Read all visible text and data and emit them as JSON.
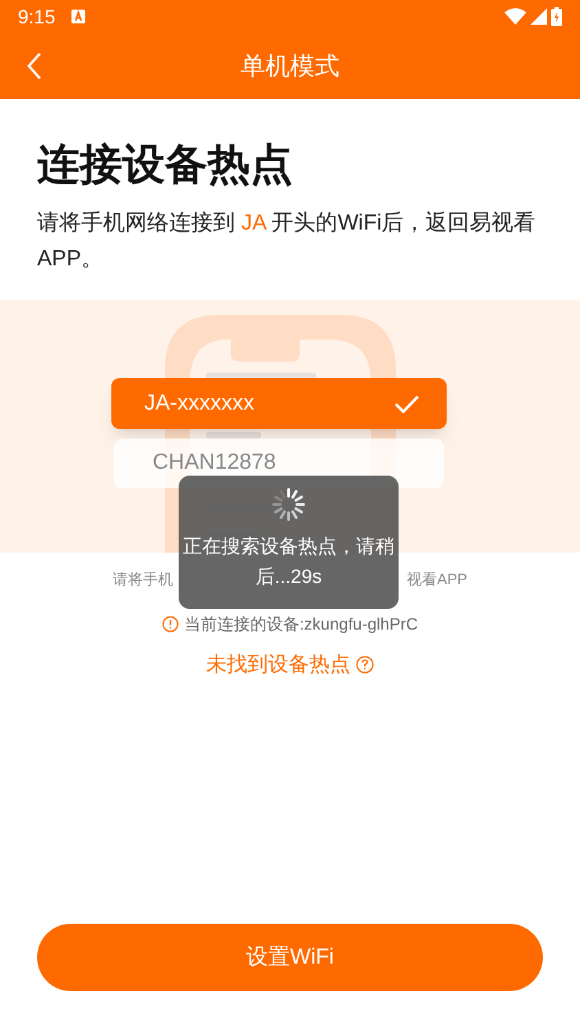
{
  "status_bar": {
    "time": "9:15"
  },
  "nav": {
    "title": "单机模式"
  },
  "heading": "连接设备热点",
  "description": "请将手机网络连接到 **JA** 开头的WiFi后，返回易视看APP。",
  "illustration": {
    "selected_network": {
      "name": "JA-xxxxxxx",
      "selected": true
    },
    "other_network": {
      "name": "CHAN12878",
      "selected": false
    }
  },
  "hint": {
    "left": "请将手机",
    "right": "视看APP"
  },
  "current_device": "当前连接的设备:zkungfu-glhPrC",
  "not_found_link": "未找到设备热点",
  "toast": {
    "message": "正在搜索设备热点，请稍后...29s"
  },
  "primary_button": "设置WiFi"
}
